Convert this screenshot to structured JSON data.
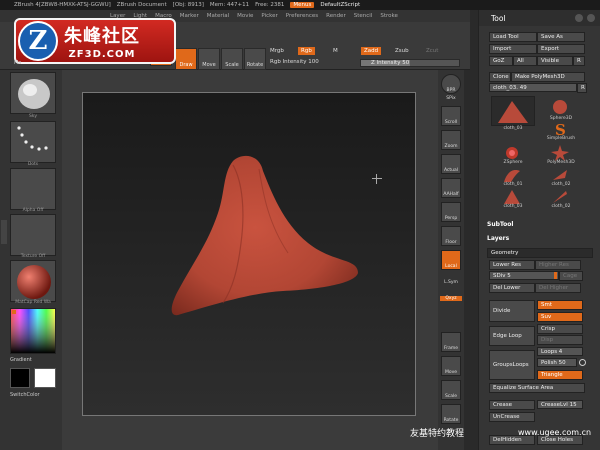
{
  "window": {
    "app_title": "ZBrush 4[ZBW8-HMXK-ATSJ-GGWU]",
    "doc_title": "ZBrush Document",
    "obj": "[Obj: 8913]",
    "mem": "Mem: 447+11",
    "free": "Free: 2381",
    "menus_label": "Menus",
    "script_label": "DefaultZScript"
  },
  "menubar": [
    "Layer",
    "Light",
    "Macro",
    "Marker",
    "Material",
    "Movie",
    "Picker",
    "Preferences",
    "Render",
    "Stencil",
    "Stroke"
  ],
  "toolbar": {
    "draw_label": "Draw",
    "move_label": "Move",
    "scale_label": "Scale",
    "rotate_label": "Rotate",
    "mrgb": "Mrgb",
    "rgb": "Rgb",
    "m": "M",
    "zadd": "Zadd",
    "zsub": "Zsub",
    "zcut": "Zcut",
    "rgb_intensity": "Rgb Intensity 100",
    "z_intensity": "Z Intensity 50",
    "z_intensity_value": 0.5
  },
  "logo": {
    "emblem": "Z",
    "cn_text": "朱峰社区",
    "en_text": "ZF3D.COM"
  },
  "left_shelf": {
    "mat_top": "Ma",
    "sky": "Sky",
    "dots": "Dots",
    "alpha": "Alpha Off",
    "texture": "Texture Off",
    "material": "MatCap Red Wa",
    "gradient": "Gradient",
    "switchcolor": "SwitchColor"
  },
  "right_shelf": {
    "bpr": "BPR",
    "spix": "SPix",
    "scroll": "Scroll",
    "zoom": "Zoom",
    "actual": "Actual",
    "aahalf": "AAHalf",
    "persp": "Persp",
    "floor": "Floor",
    "local": "Local",
    "lsym": "L.Sym",
    "xyz": "Qxyz",
    "frame": "Frame",
    "move": "Move",
    "scale": "Scale",
    "rotate": "Rotate"
  },
  "tool_palette": {
    "title": "Tool",
    "load_tool": "Load Tool",
    "save_as": "Save As",
    "import": "Import",
    "export": "Export",
    "goz": "GoZ",
    "all": "All",
    "visible": "Visible",
    "r": "R",
    "clone": "Clone",
    "make_polymesh": "Make PolyMesh3D",
    "current_tool": "cloth_03. 49",
    "tools": [
      {
        "name": "cloth_03"
      },
      {
        "name": "Sphere3D"
      },
      {
        "name": "SimpleBrush"
      },
      {
        "name": "ZSphere"
      },
      {
        "name": "PolyMesh3D"
      },
      {
        "name": "cloth_01"
      },
      {
        "name": "cloth_02"
      },
      {
        "name": "cloth_03"
      },
      {
        "name": "cloth_02"
      }
    ],
    "subtool": "SubTool",
    "layers": "Layers",
    "geometry": "Geometry",
    "lower_res": "Lower Res",
    "higher_res": "Higher Res",
    "sdiv": "SDiv 5",
    "cage": "Cage",
    "del_lower": "Del Lower",
    "del_higher": "Del Higher",
    "divide": "Divide",
    "smt": "Smt",
    "suv": "Suv",
    "edge_loop": "Edge Loop",
    "crisp": "Crisp",
    "disp": "Disp",
    "groups_loops": "GroupsLoops",
    "loops": "Loops 4",
    "polish": "Polish 50",
    "triangle": "Triangle",
    "equalize": "Equalize Surface Area",
    "crease": "Crease",
    "crease_lvl": "CreaseLvl 15",
    "uncrease": "UnCrease",
    "delhidden": "DelHidden",
    "close_holes": "Close Holes"
  },
  "watermark": {
    "cn": "友基特约教程",
    "url": "www.ugee.com.cn"
  },
  "colors": {
    "accent": "#e0691a",
    "model": "#b84a3a"
  }
}
